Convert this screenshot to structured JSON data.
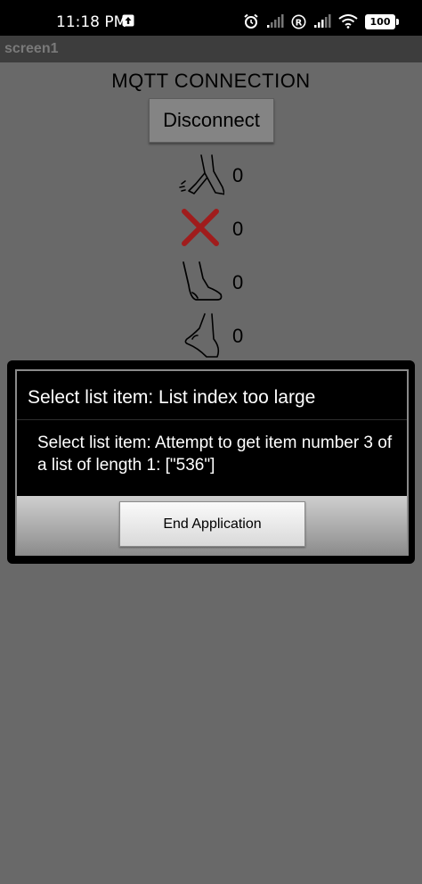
{
  "status_bar": {
    "time": "11:18 PM",
    "battery": "100",
    "icons": [
      "upload-icon",
      "alarm-icon",
      "signal-icon",
      "roaming-r-icon",
      "signal-icon-2",
      "wifi-icon",
      "battery-icon"
    ]
  },
  "app": {
    "screen_title": "screen1",
    "heading": "MQTT CONNECTION",
    "disconnect_label": "Disconnect"
  },
  "sensors": [
    {
      "icon": "foot-kick-icon",
      "value": "0"
    },
    {
      "icon": "red-x-icon",
      "value": "0"
    },
    {
      "icon": "foot-side-icon",
      "value": "0"
    },
    {
      "icon": "foot-arch-icon",
      "value": "0"
    }
  ],
  "dialog": {
    "title": "Select list item: List index too large",
    "message": "Select list item: Attempt to get item number 3 of a list of length 1: [\"536\"]",
    "button_label": "End Application"
  },
  "colors": {
    "background": "#696969",
    "red_x": "#a01c1c",
    "dialog_bg": "#000000"
  }
}
